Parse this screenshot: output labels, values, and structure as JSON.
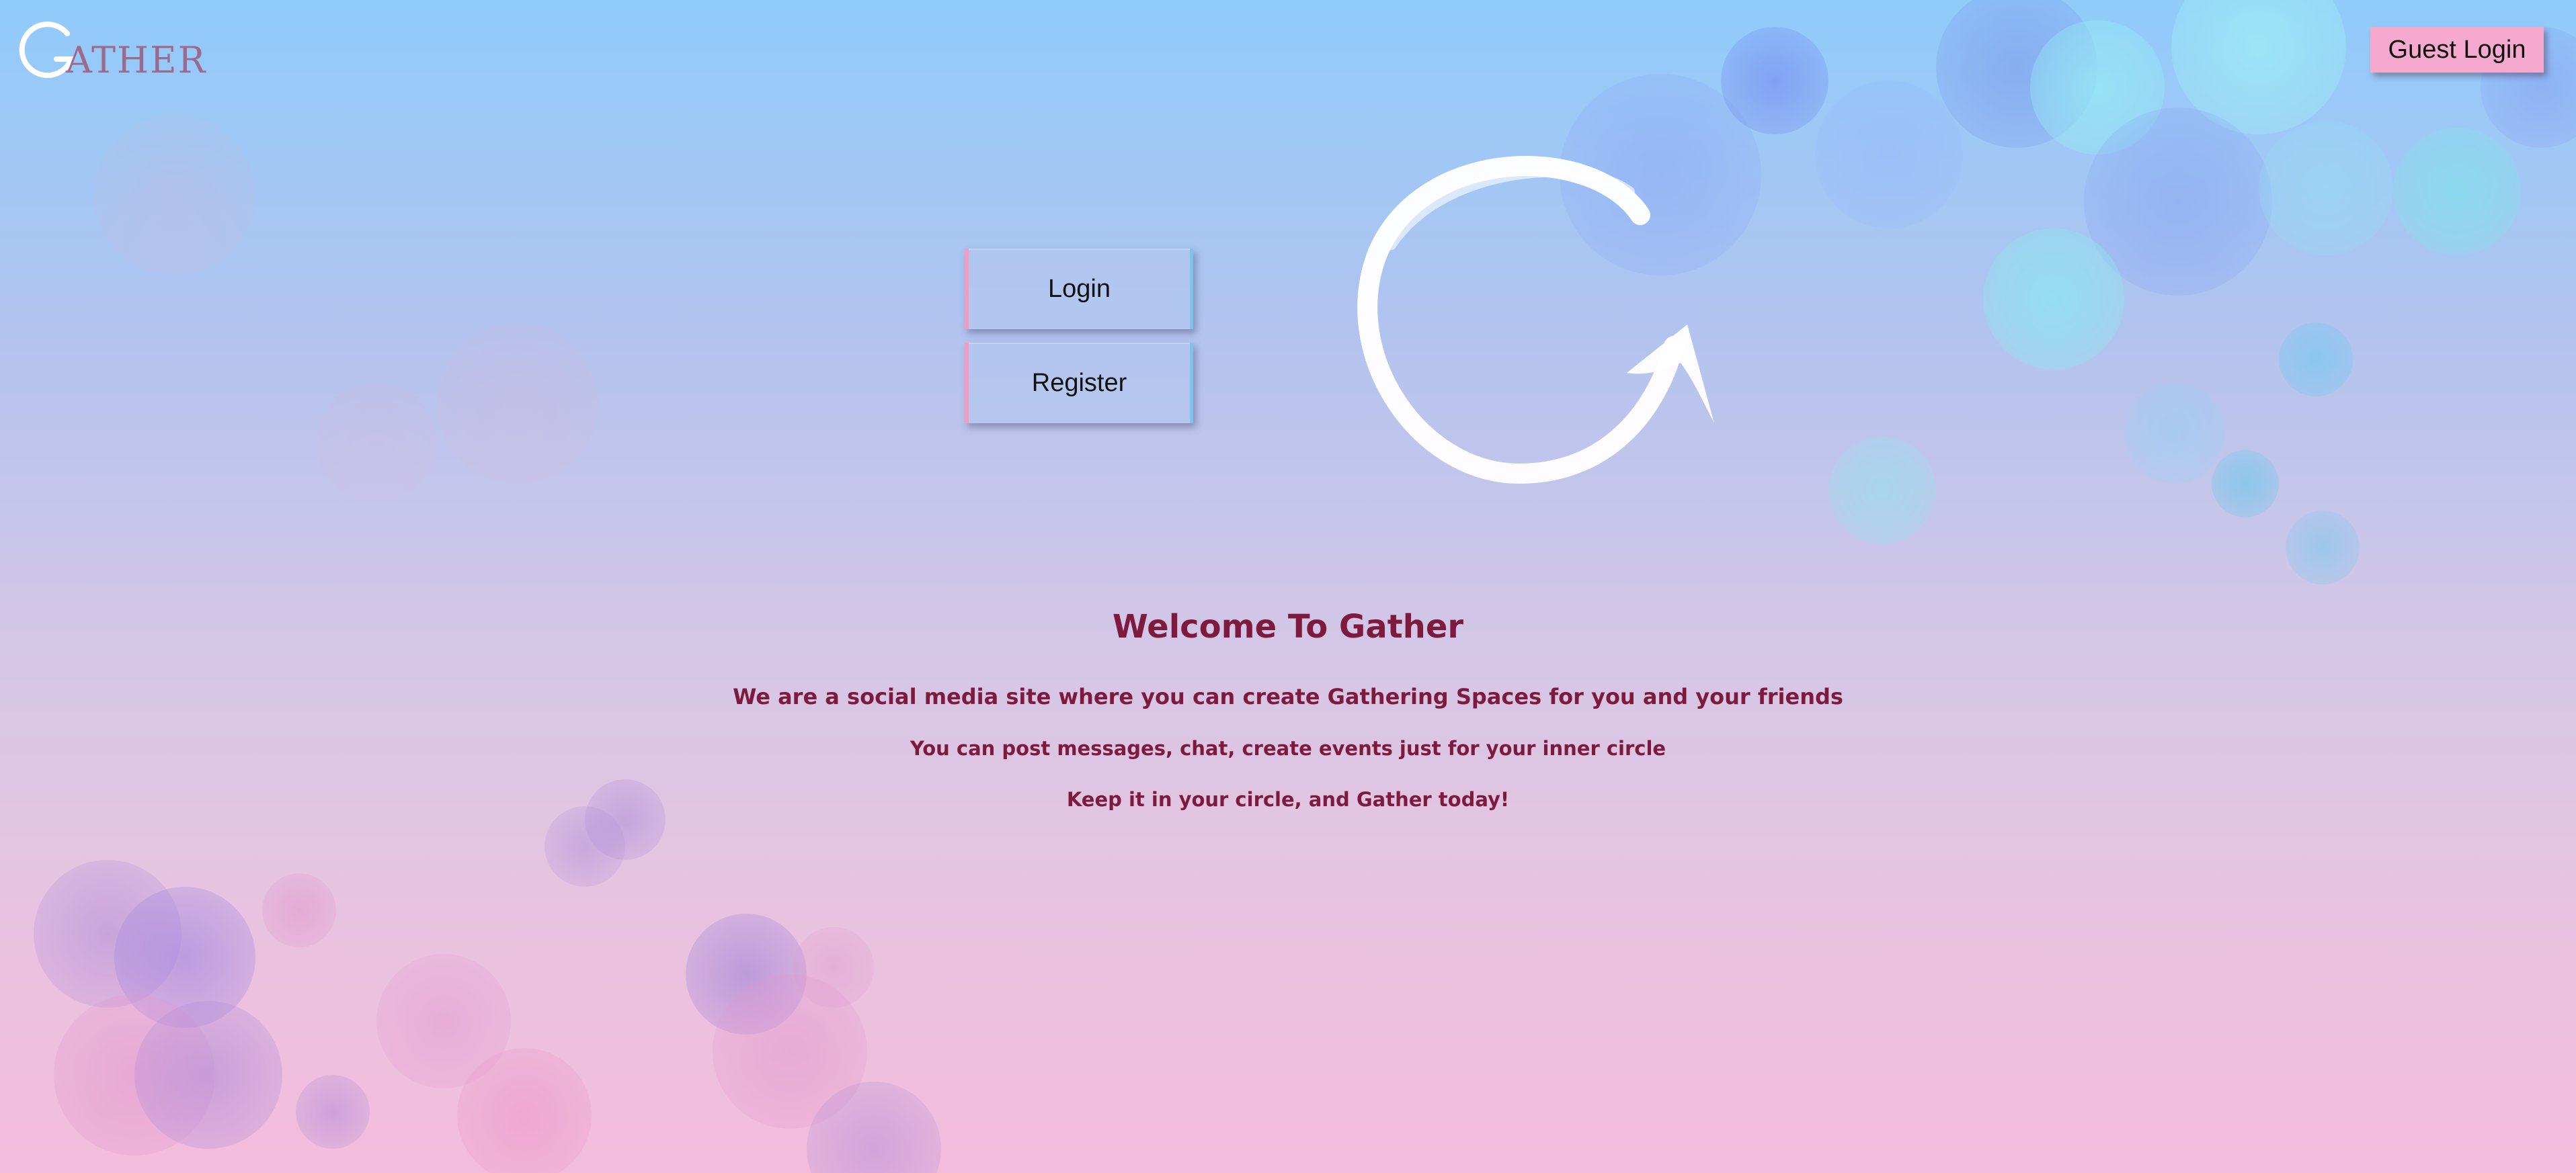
{
  "header": {
    "logo_text": "ATHER",
    "guest_login_label": "Guest Login"
  },
  "auth": {
    "login_label": "Login",
    "register_label": "Register"
  },
  "welcome": {
    "title": "Welcome To Gather",
    "line1": "We are a social media site where you can create Gathering Spaces for you and your friends",
    "line2": "You can post messages, chat, create events just for your inner circle",
    "line3": "Keep it in your circle, and Gather today!"
  },
  "icons": {
    "brand_logo": "gather-g-icon",
    "hero_logo": "circular-arrow-icon"
  },
  "colors": {
    "accent_text": "#7e1a3e",
    "guest_button": "#f5a9cf"
  }
}
